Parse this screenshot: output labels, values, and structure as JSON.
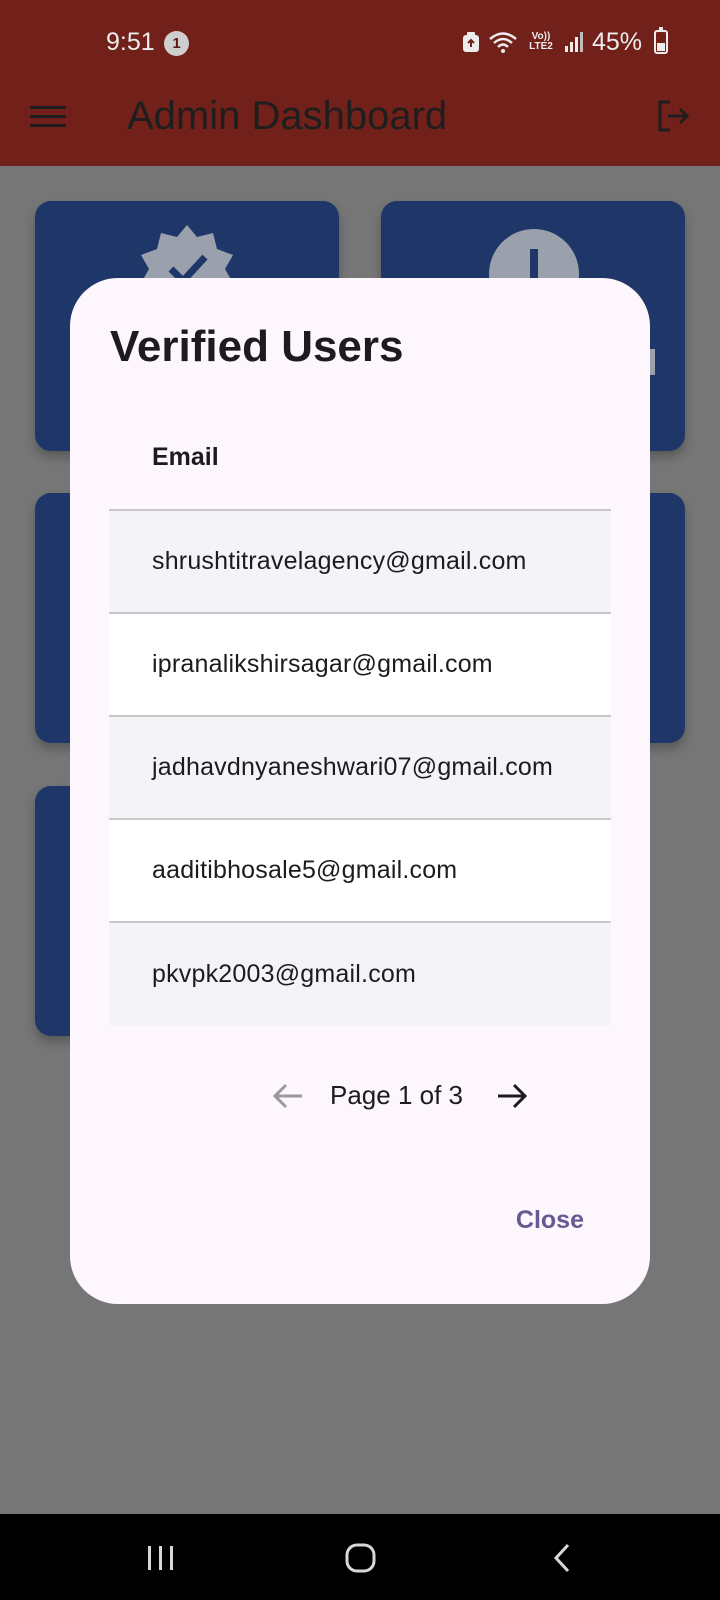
{
  "status_bar": {
    "time": "9:51",
    "notification_count": "1",
    "network_label": "Vo)) LTE2",
    "battery_percent": "45%",
    "battery_level": 0.45
  },
  "app_bar": {
    "title": "Admin Dashboard",
    "background_color": "#72201a"
  },
  "dialog": {
    "title": "Verified Users",
    "column_header": "Email",
    "rows": [
      "shrushtitravelagency@gmail.com",
      "ipranalikshirsagar@gmail.com",
      "jadhavdnyaneshwari07@gmail.com",
      "aaditibhosale5@gmail.com",
      "pkvpk2003@gmail.com"
    ],
    "pagination": {
      "label": "Page 1 of 3",
      "current_page": 1,
      "total_pages": 3,
      "prev_enabled": false,
      "next_enabled": true
    },
    "close_label": "Close",
    "accent_color": "#655a92"
  },
  "icons": {
    "menu": "menu-icon",
    "logout": "logout-icon",
    "verified": "verified-badge-icon",
    "alert": "alert-icon",
    "prev": "arrow-left-icon",
    "next": "arrow-right-icon",
    "nav_recents": "recents-icon",
    "nav_home": "home-icon",
    "nav_back": "back-icon"
  }
}
